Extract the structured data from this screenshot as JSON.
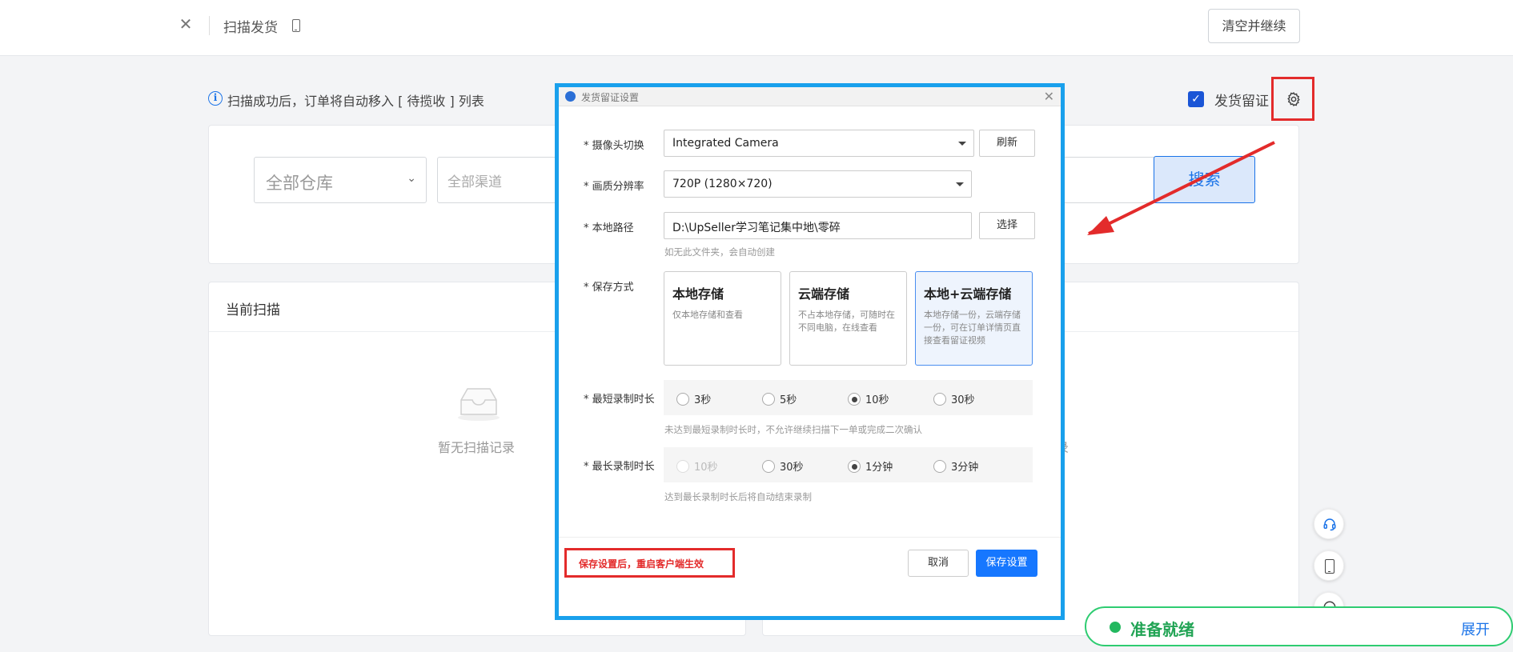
{
  "header": {
    "title": "扫描发货",
    "clear_button": "清空并继续"
  },
  "info": {
    "message": "扫描成功后，订单将自动移入 [ 待揽收 ] 列表",
    "checkbox_label": "发货留证",
    "checkbox_checked": true
  },
  "filters": {
    "warehouse": "全部仓库",
    "channel": "全部渠道",
    "search_button": "搜索"
  },
  "scan_panel": {
    "title": "当前扫描",
    "empty_text": "暂无扫描记录",
    "right_fragment": "录"
  },
  "status_bar": {
    "status": "准备就绪",
    "expand": "展开"
  },
  "dialog": {
    "title": "发货留证设置",
    "camera": {
      "label": "* 摄像头切换",
      "value": "Integrated Camera",
      "refresh": "刷新"
    },
    "resolution": {
      "label": "* 画质分辨率",
      "value": "720P (1280×720)"
    },
    "path": {
      "label": "* 本地路径",
      "value": "D:\\UpSeller学习笔记集中地\\零碎",
      "choose": "选择",
      "hint": "如无此文件夹，会自动创建"
    },
    "storage": {
      "label": "* 保存方式",
      "options": [
        {
          "title": "本地存储",
          "desc": "仅本地存储和查看"
        },
        {
          "title": "云端存储",
          "desc": "不占本地存储，可随时在不同电脑，在线查看"
        },
        {
          "title": "本地+云端存储",
          "desc": "本地存储一份，云端存储一份，可在订单详情页直接查看留证视频"
        }
      ],
      "selected": 2
    },
    "min_duration": {
      "label": "* 最短录制时长",
      "options": [
        "3秒",
        "5秒",
        "10秒",
        "30秒"
      ],
      "selected": "10秒",
      "hint": "未达到最短录制时长时，不允许继续扫描下一单或完成二次确认"
    },
    "max_duration": {
      "label": "* 最长录制时长",
      "options": [
        "10秒",
        "30秒",
        "1分钟",
        "3分钟"
      ],
      "selected": "1分钟",
      "disabled": "10秒",
      "hint": "达到最长录制时长后将自动结束录制"
    },
    "footer_note": "保存设置后，重启客户端生效",
    "cancel": "取消",
    "save": "保存设置"
  },
  "colors": {
    "primary": "#1677ff",
    "dialog_border": "#19a0ec",
    "annotation_red": "#e32b2b",
    "ready_green": "#23b85f"
  }
}
